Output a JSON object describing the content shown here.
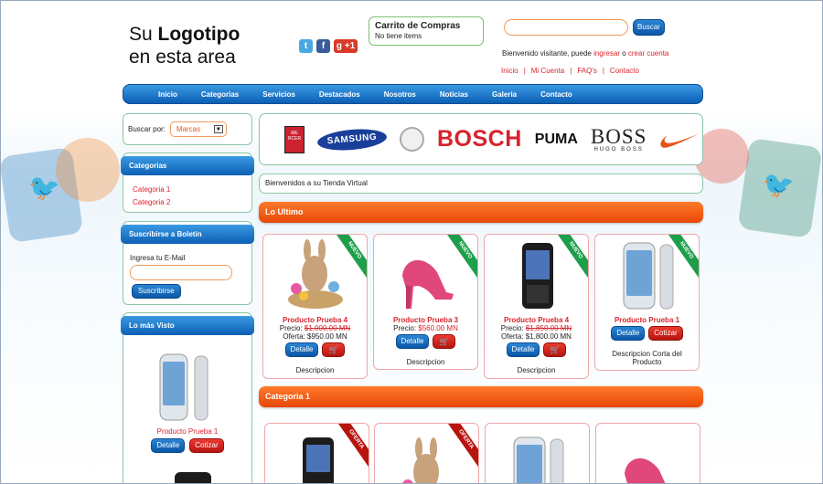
{
  "header": {
    "logo_line1_pre": "Su ",
    "logo_line1_bold": "Logotipo",
    "logo_line2": "en esta area",
    "social": [
      "twitter-icon",
      "facebook-icon",
      "google-plus-icon"
    ],
    "social_labels": {
      "twitter": "t",
      "facebook": "f",
      "google": "g +1"
    },
    "cart_title": "Carrito de Compras",
    "cart_status": "No tiene items",
    "search_placeholder": "",
    "search_button": "Buscar",
    "welcome_text": "Bienvenido visitante, puede ",
    "welcome_login": "ingresar",
    "welcome_or": " o ",
    "welcome_register": "crear cuenta",
    "toplinks": [
      "Inicio",
      "Mi Cuenta",
      "FAQ's",
      "Contacto"
    ]
  },
  "nav": [
    "Inicio",
    "Categorias",
    "Servicios",
    "Destacados",
    "Nosotros",
    "Noticias",
    "Galeria",
    "Contacto"
  ],
  "sidebar": {
    "filter_label": "Buscar por:",
    "filter_value": "Marcas",
    "categories_title": "Categorias",
    "categories": [
      "Categoria 1",
      "Categoria 2"
    ],
    "newsletter_title": "Suscribirse a Boletin",
    "newsletter_label": "Ingresa tu E-Mail",
    "newsletter_button": "Suscribirse",
    "most_seen_title": "Lo más Visto",
    "most_seen_product": "Producto Prueba 1",
    "most_seen_detail": "Detalle",
    "most_seen_cart": "Cotizar"
  },
  "brands": {
    "mercer": "ME RCER",
    "samsung": "SAMSUNG",
    "bosch": "BOSCH",
    "puma": "PUMA",
    "boss": "BOSS",
    "boss_sub": "HUGO BOSS",
    "nike": "nike-swoosh"
  },
  "main": {
    "welcome_message": "Bienvenidos a su Tienda Virtual",
    "section1_title": "Lo Ultimo",
    "section2_title": "Categoria 1",
    "products": [
      {
        "name": "Producto Prueba 4",
        "ribbon": "NUEVO",
        "price_label": "Precio: ",
        "price": "$1,000.00 MN",
        "offer": "Oferta: $950.00 MN",
        "desc": "Descripcion"
      },
      {
        "name": "Producto Prueba 3",
        "ribbon": "NUEVO",
        "price_label": "Precio: ",
        "price": "$560.00 MN",
        "offer": "",
        "desc": "Descripcion"
      },
      {
        "name": "Producto Prueba 4",
        "ribbon": "NUEVO",
        "price_label": "Precio: ",
        "price": "$1,850.00 MN",
        "offer": "Oferta: $1,800.00 MN",
        "desc": "Descripcion"
      },
      {
        "name": "Producto Prueba 1",
        "ribbon": "NUEVO",
        "price_label": "",
        "price": "",
        "offer": "",
        "desc": "Descripcion Corta del Producto"
      }
    ],
    "detail_label": "Detalle",
    "quote_label": "Cotizar",
    "cart_glyph": "🛒",
    "section2_ribbons": [
      "OFERTA",
      "OFERTA"
    ]
  },
  "colors": {
    "accent_blue": "#0c5fb4",
    "accent_orange": "#e84708",
    "link_red": "#d6262e"
  }
}
